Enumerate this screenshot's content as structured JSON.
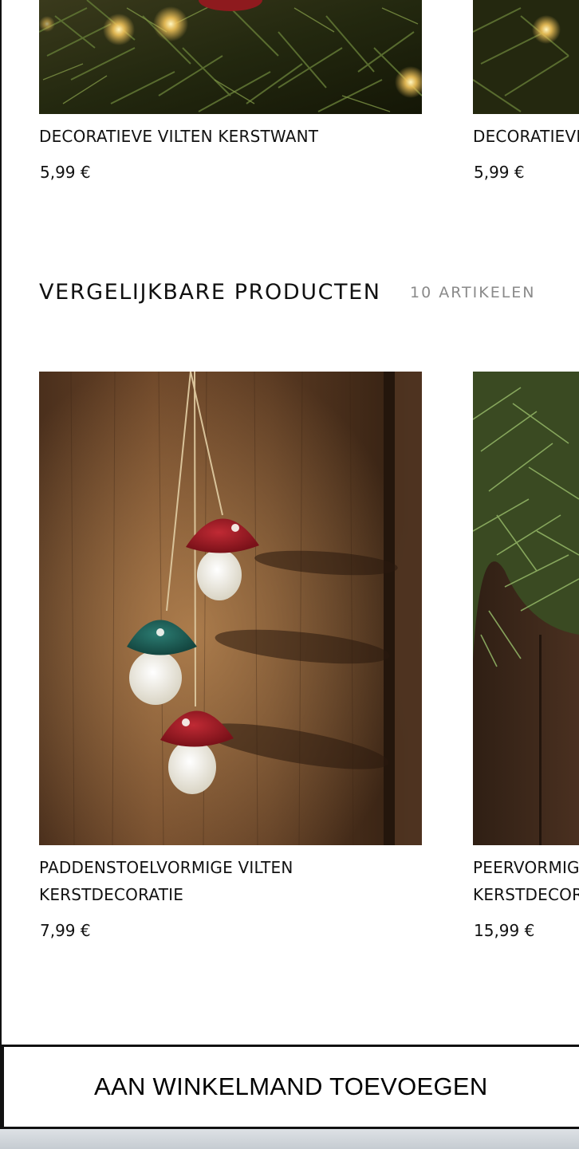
{
  "top_products": [
    {
      "title": "DECORATIEVE VILTEN KERSTWANT",
      "price": "5,99 €"
    },
    {
      "title": "DECORATIEVE VILTEN KERSTWANT",
      "price": "5,99 €"
    }
  ],
  "similar_section": {
    "title": "VERGELIJKBARE PRODUCTEN",
    "count": "10 ARTIKELEN"
  },
  "similar_products": [
    {
      "title_line1": "PADDENSTOELVORMIGE VILTEN",
      "title_line2": "KERSTDECORATIE",
      "price": "7,99 €"
    },
    {
      "title_line1": "PEERVORMIGE",
      "title_line2": "KERSTDECORATIE",
      "price": "15,99 €"
    }
  ],
  "cart_button": {
    "label": "AAN WINKELMAND TOEVOEGEN"
  },
  "colors": {
    "text": "#111111",
    "muted": "#8a8a8a",
    "border": "#111111"
  }
}
